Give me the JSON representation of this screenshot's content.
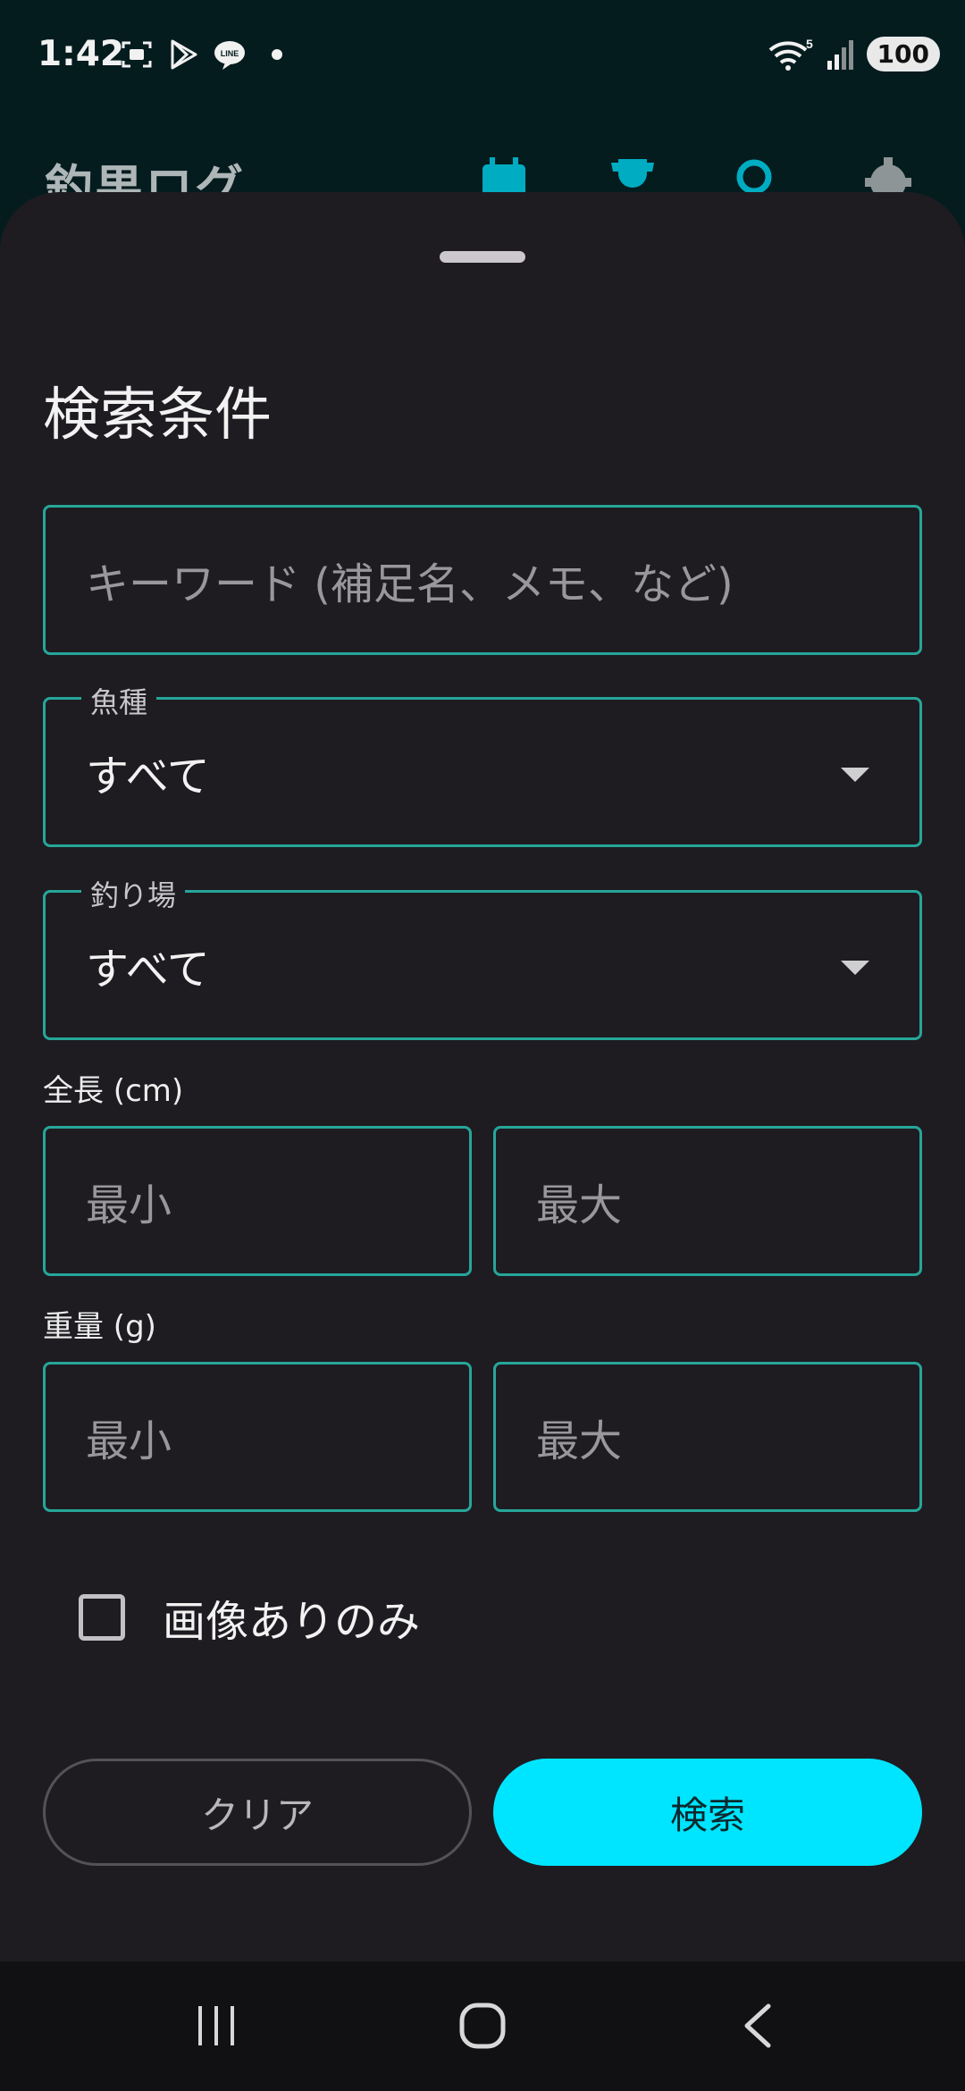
{
  "status_bar": {
    "time": "1:42",
    "battery": "100",
    "network": "5"
  },
  "app_bar": {
    "title": "釣果ログ",
    "accent_color": "#00bcd4"
  },
  "sheet": {
    "title": "検索条件",
    "keyword": {
      "placeholder": "キーワード (補足名、メモ、など)",
      "value": ""
    },
    "fish_species": {
      "label": "魚種",
      "value": "すべて"
    },
    "fishing_spot": {
      "label": "釣り場",
      "value": "すべて"
    },
    "length": {
      "label": "全長 (cm)",
      "min_placeholder": "最小",
      "max_placeholder": "最大"
    },
    "weight": {
      "label": "重量 (g)",
      "min_placeholder": "最小",
      "max_placeholder": "最大"
    },
    "image_only": {
      "label": "画像ありのみ",
      "checked": false
    },
    "clear_label": "クリア",
    "search_label": "検索"
  },
  "colors": {
    "field_border": "#26a69a",
    "primary_button": "#00e5ff",
    "sheet_background": "#1e1c21"
  }
}
